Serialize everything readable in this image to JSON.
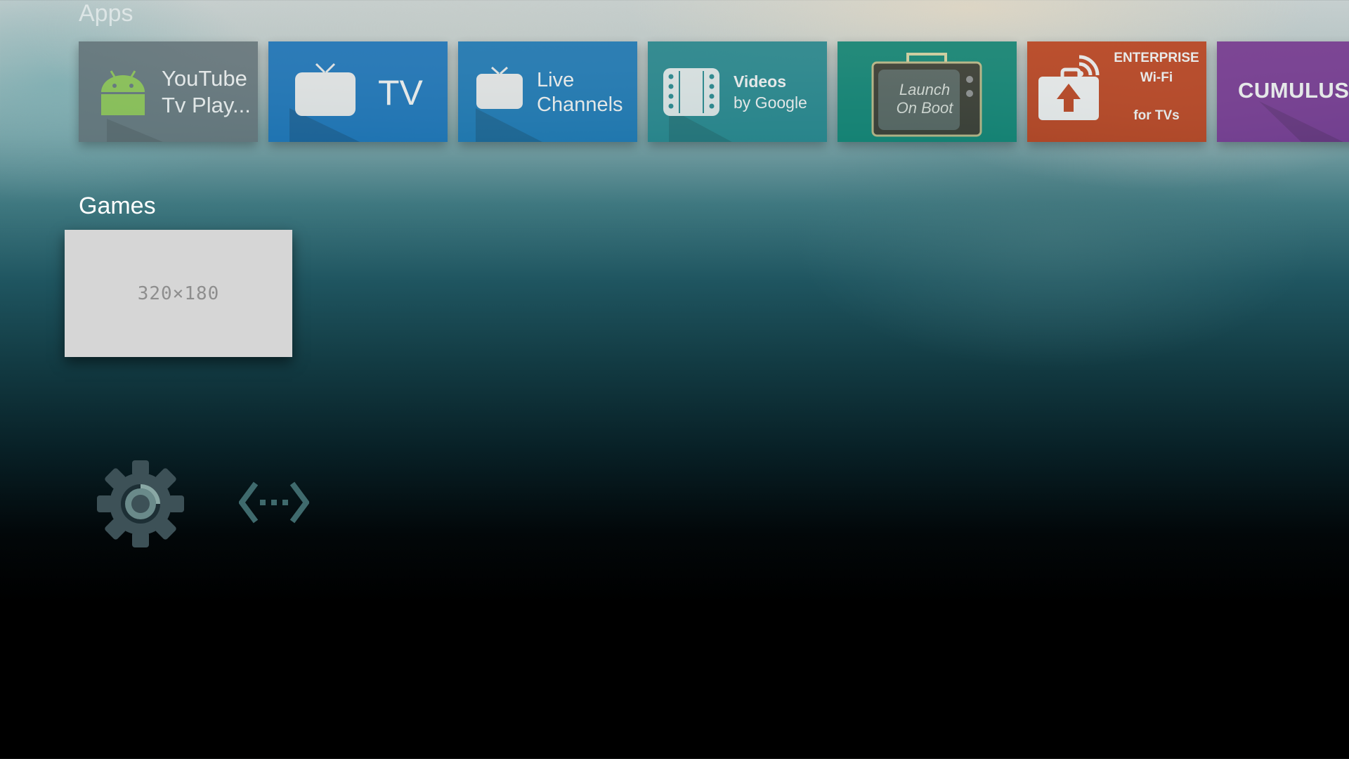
{
  "sections": {
    "apps_title": "Apps",
    "games_title": "Games"
  },
  "apps": [
    {
      "line1": "YouTube",
      "line2": "Tv Play...",
      "icon": "android-icon"
    },
    {
      "line1": "TV",
      "icon": "tv-icon"
    },
    {
      "line1": "Live",
      "line2": "Channels",
      "icon": "tv-icon"
    },
    {
      "line1": "Videos",
      "line2": "by Google",
      "icon": "film-strip-icon"
    },
    {
      "line1": "Launch",
      "line2": "On Boot",
      "icon": "retro-tv-icon"
    },
    {
      "line1": "ENTERPRISE",
      "line2": "Wi-Fi",
      "line3": "for TVs",
      "icon": "wifi-upload-icon"
    },
    {
      "line1": "CUMULUS",
      "icon": ""
    }
  ],
  "games": {
    "placeholder": "320×180"
  },
  "colors": {
    "youtube_tile": "#5f6e74",
    "tv_tile": "#0d6bb5",
    "live_channels_tile": "#0e6fb0",
    "videos_tile": "#187f86",
    "launch_on_boot_tile": "#007c6a",
    "enterprise_tile": "#b8350e",
    "cumulus_tile": "#6f2a8a"
  },
  "bottom_icons": [
    "gear-icon",
    "network-icon"
  ]
}
